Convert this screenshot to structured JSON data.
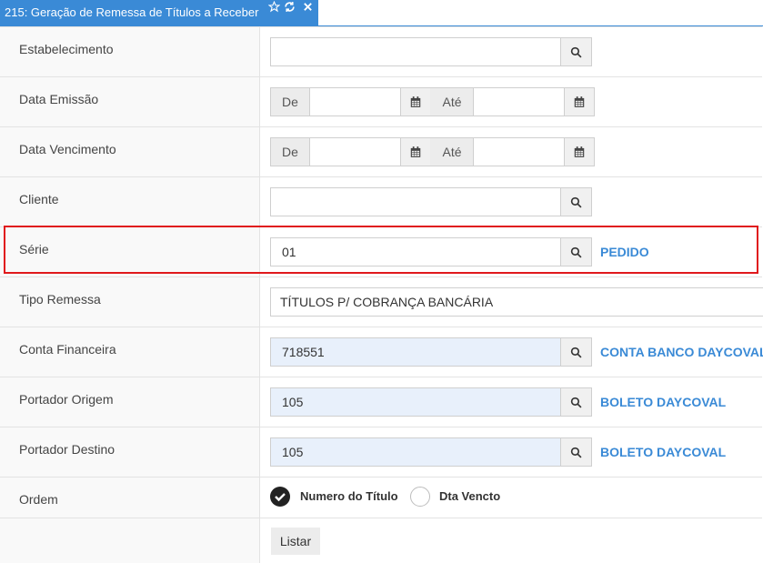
{
  "tab": {
    "title": "215: Geração de Remessa de Títulos a Receber"
  },
  "fields": {
    "estabelecimento": {
      "label": "Estabelecimento",
      "value": ""
    },
    "data_emissao": {
      "label": "Data Emissão",
      "de": "De",
      "ate": "Até",
      "from": "",
      "to": ""
    },
    "data_vencimento": {
      "label": "Data Vencimento",
      "de": "De",
      "ate": "Até",
      "from": "",
      "to": ""
    },
    "cliente": {
      "label": "Cliente",
      "value": ""
    },
    "serie": {
      "label": "Série",
      "value": "01",
      "desc": "PEDIDO"
    },
    "tipo_remessa": {
      "label": "Tipo Remessa",
      "value": "TÍTULOS P/ COBRANÇA BANCÁRIA"
    },
    "conta_financeira": {
      "label": "Conta Financeira",
      "value": "718551",
      "desc": "CONTA BANCO DAYCOVAL"
    },
    "portador_origem": {
      "label": "Portador Origem",
      "value": "105",
      "desc": "BOLETO DAYCOVAL"
    },
    "portador_destino": {
      "label": "Portador Destino",
      "value": "105",
      "desc": "BOLETO DAYCOVAL"
    },
    "ordem": {
      "label": "Ordem",
      "options": [
        "Numero do Título",
        "Dta Vencto"
      ],
      "selected": "Numero do Título"
    }
  },
  "buttons": {
    "listar": "Listar"
  },
  "icons": {
    "favorite": "star-outline-icon",
    "refresh": "refresh-icon",
    "close": "close-icon",
    "search": "search-icon",
    "calendar": "calendar-icon"
  },
  "colors": {
    "accent": "#3a8ad6",
    "highlight": "#e0191c",
    "filled_input": "#e8f0fb"
  }
}
